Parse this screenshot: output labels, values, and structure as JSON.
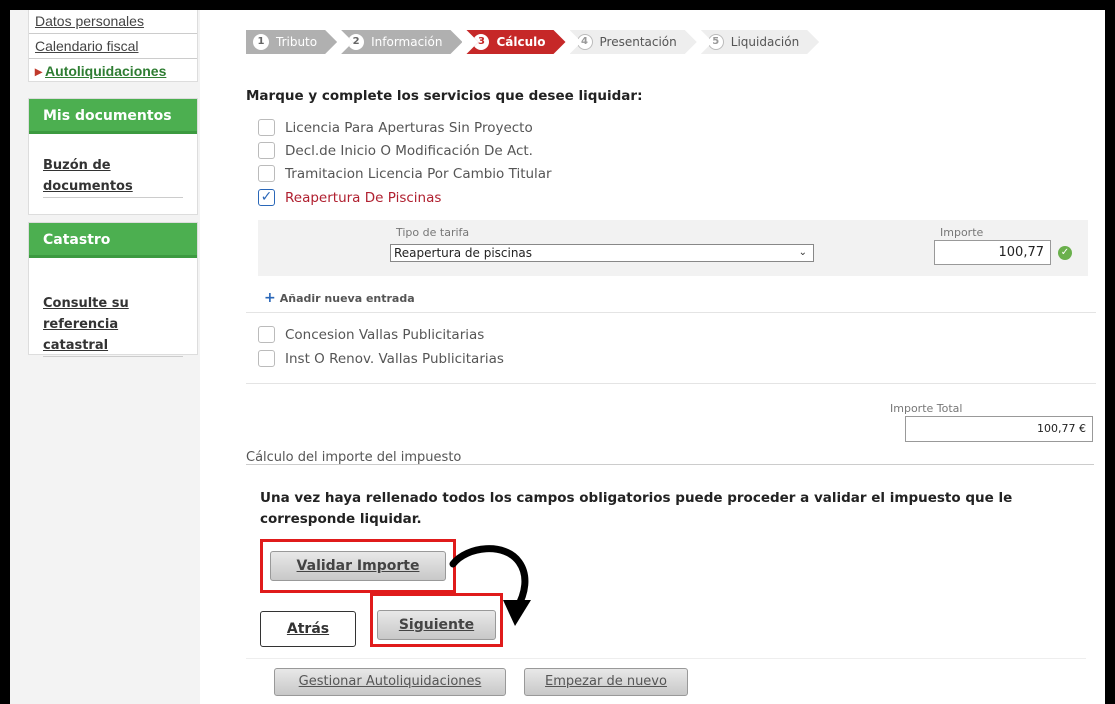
{
  "sidebar": {
    "links": [
      "Datos personales",
      "Calendario fiscal",
      "Autoliquidaciones"
    ],
    "mis_documentos": {
      "heading": "Mis documentos",
      "link": "Buzón de documentos"
    },
    "catastro": {
      "heading": "Catastro",
      "link": "Consulte su referencia catastral"
    }
  },
  "stepper": {
    "steps": [
      {
        "num": "1",
        "label": "Tributo"
      },
      {
        "num": "2",
        "label": "Información"
      },
      {
        "num": "3",
        "label": "Cálculo"
      },
      {
        "num": "4",
        "label": "Presentación"
      },
      {
        "num": "5",
        "label": "Liquidación"
      }
    ]
  },
  "instructions": "Marque y complete los servicios que desee liquidar:",
  "services": {
    "s1": "Licencia Para Aperturas Sin Proyecto",
    "s2": "Decl.de Inicio O Modificación De Act.",
    "s3": "Tramitacion Licencia Por Cambio Titular",
    "s4": "Reapertura De Piscinas",
    "s5": "Concesion Vallas Publicitarias",
    "s6": "Inst O Renov. Vallas Publicitarias"
  },
  "entry": {
    "tarifa_label": "Tipo de tarifa",
    "tarifa_value": "Reapertura de piscinas",
    "importe_label": "Importe",
    "importe_value": "100,77"
  },
  "add_entry": "Añadir nueva entrada",
  "total": {
    "label": "Importe Total",
    "value": "100,77 €"
  },
  "calc_title": "Cálculo del importe del impuesto",
  "info_text": "Una vez haya rellenado todos los campos obligatorios puede proceder a validar el impuesto que le corresponde liquidar.",
  "buttons": {
    "validar": "Validar Importe",
    "atras": "Atrás",
    "siguiente": "Siguiente",
    "gestionar": "Gestionar Autoliquidaciones",
    "empezar": "Empezar de nuevo"
  },
  "colors": {
    "accent_green": "#4caf50",
    "step_active": "#c62828",
    "highlight": "#e01b1b"
  }
}
